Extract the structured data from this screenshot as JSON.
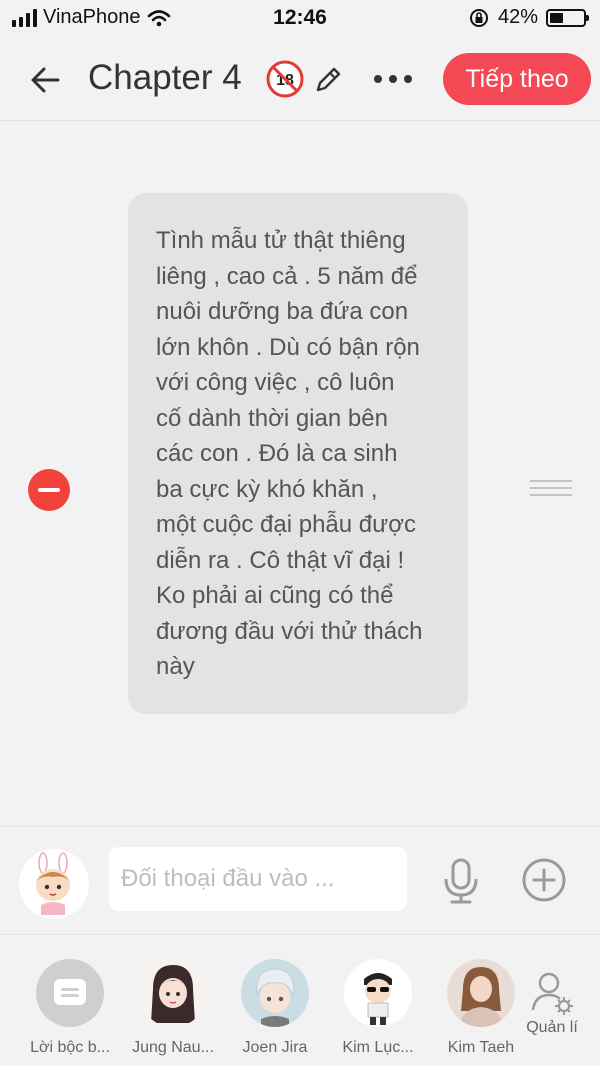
{
  "status_bar": {
    "carrier": "VinaPhone",
    "time": "12:46",
    "battery_percent": "42%",
    "battery_level": 0.42
  },
  "header": {
    "title": "Chapter 4",
    "next_label": "Tiếp theo",
    "icons": [
      "back-arrow-icon",
      "age-18-icon",
      "pencil-icon",
      "more-icon"
    ]
  },
  "message": {
    "text": "Tình mẫu tử thật thiêng\nliêng , cao cả . 5 năm để\nnuôi dưỡng ba đứa con\nlớn khôn . Dù có bận rộn\nvới công việc , cô luôn\ncố dành thời gian bên\ncác con . Đó là ca sinh\nba cực kỳ khó khăn ,\nmột cuộc đại phẫu được\ndiễn ra . Cô thật vĩ đại !\nKo phải ai cũng có thể\nđương đầu với thử thách\nnày"
  },
  "input": {
    "placeholder": "Đối thoại đầu vào ..."
  },
  "characters": [
    {
      "name": "Lời bộc b...",
      "avatar": "narration-icon"
    },
    {
      "name": "Jung Nau...",
      "avatar": "girl-avatar"
    },
    {
      "name": "Joen Jira",
      "avatar": "white-hair-avatar"
    },
    {
      "name": "Kim Lục...",
      "avatar": "sunglasses-avatar"
    },
    {
      "name": "Kim Taeh",
      "avatar": "photo-avatar"
    }
  ],
  "manage_label": "Quản lí",
  "colors": {
    "accent": "#f44855",
    "delete": "#f2423b",
    "bubble": "#e3e3e3",
    "background": "#f2f2f2"
  }
}
